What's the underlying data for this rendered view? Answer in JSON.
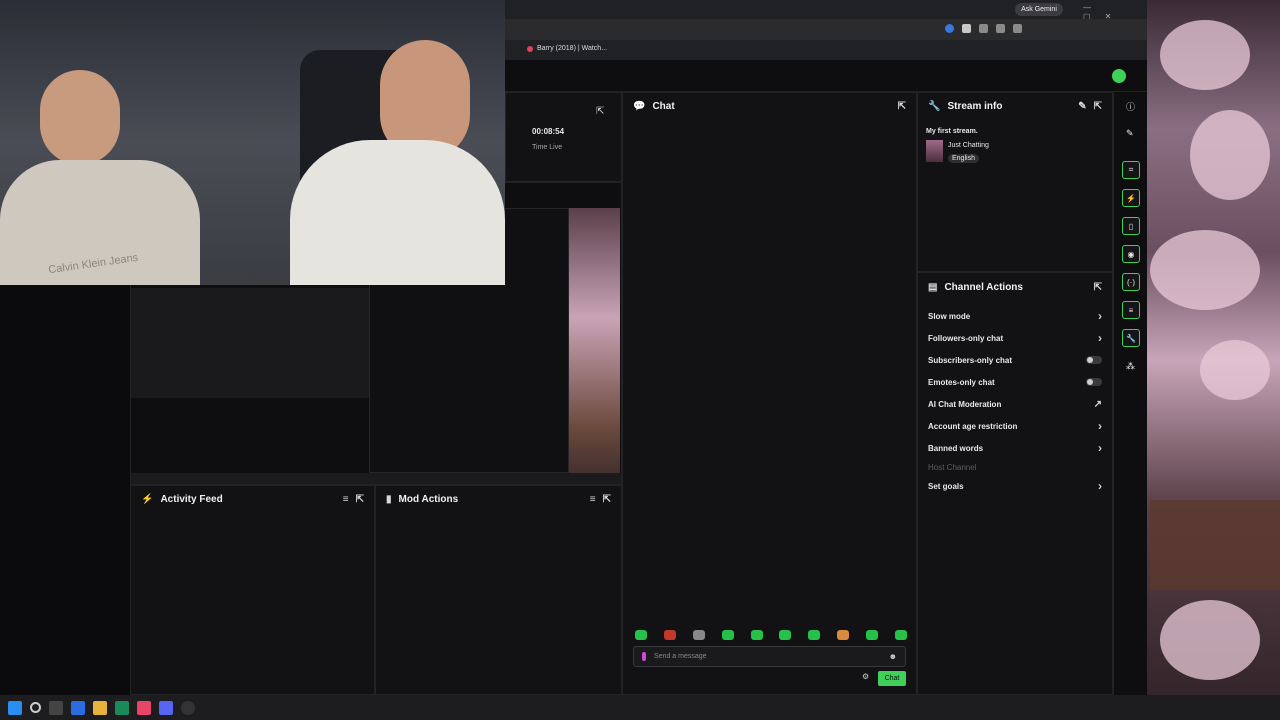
{
  "browser": {
    "ask_gemini": "Ask Gemini",
    "tab_title": "Barry (2018) | Watch...",
    "window_controls": [
      "—",
      "▢",
      "✕"
    ]
  },
  "stream_stats": {
    "time_live_value": "00:08:54",
    "time_live_label": "Time Live"
  },
  "chat": {
    "title": "Chat",
    "input_placeholder": "Send a message",
    "send_label": "Chat"
  },
  "stream_info": {
    "title": "Stream info",
    "stream_title": "My first stream.",
    "category": "Just Chatting",
    "language": "English"
  },
  "channel_actions": {
    "title": "Channel Actions",
    "items": [
      {
        "label": "Slow mode",
        "control": "chevron"
      },
      {
        "label": "Followers-only chat",
        "control": "chevron"
      },
      {
        "label": "Subscribers-only chat",
        "control": "toggle"
      },
      {
        "label": "Emotes-only chat",
        "control": "toggle"
      },
      {
        "label": "AI Chat Moderation",
        "control": "external"
      },
      {
        "label": "Account age restriction",
        "control": "chevron"
      },
      {
        "label": "Banned words",
        "control": "chevron"
      },
      {
        "label": "Host Channel",
        "control": "none"
      },
      {
        "label": "Set goals",
        "control": "chevron"
      }
    ]
  },
  "activity_feed": {
    "title": "Activity Feed"
  },
  "mod_actions": {
    "title": "Mod Actions"
  },
  "webcam": {
    "shirt_text": "Calvin Klein Jeans"
  },
  "colors": {
    "accent": "#3fd05a",
    "panel_bg": "#121214"
  }
}
